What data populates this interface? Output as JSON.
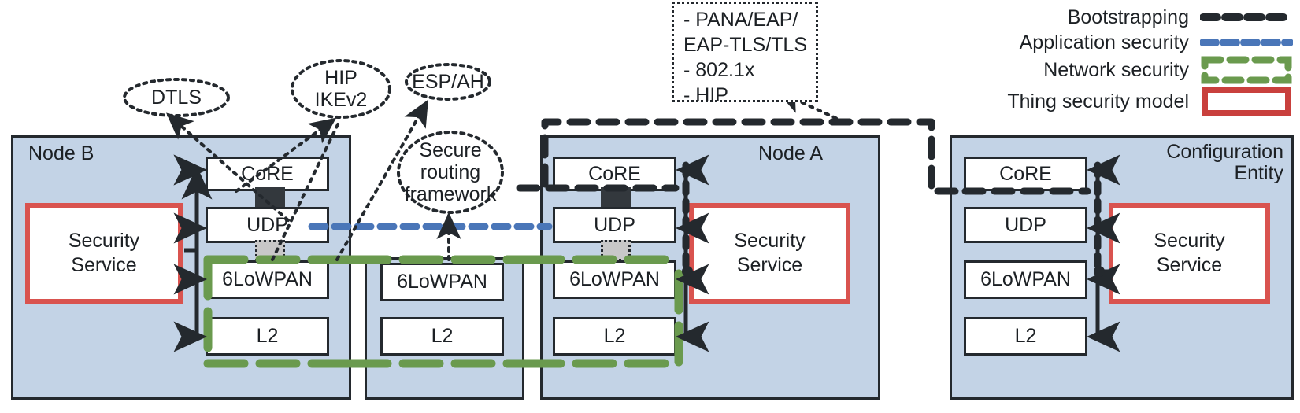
{
  "legend": {
    "items": [
      {
        "label": "Bootstrapping",
        "style": "dashed-black",
        "color": "#24292e"
      },
      {
        "label": "Application security",
        "style": "dotted-blue",
        "color": "#4a76b8"
      },
      {
        "label": "Network security",
        "style": "dashed-green-box",
        "color": "#6a9a4e"
      },
      {
        "label": "Thing security model",
        "style": "solid-red-box",
        "color": "#c9403d"
      }
    ]
  },
  "callout": {
    "lines": [
      "- PANA/EAP/",
      "EAP-TLS/TLS",
      "- 802.1x",
      "- HIP"
    ]
  },
  "ellipses": [
    {
      "id": "dtls",
      "lines": [
        "DTLS"
      ]
    },
    {
      "id": "hip-ikev2",
      "lines": [
        "HIP",
        "IKEv2"
      ]
    },
    {
      "id": "esp-ah",
      "lines": [
        "ESP/AH"
      ]
    },
    {
      "id": "secure-routing",
      "lines": [
        "Secure",
        "routing",
        "framework"
      ]
    }
  ],
  "nodes": [
    {
      "id": "node-b",
      "title_lines": [
        "Node B"
      ],
      "security_service": {
        "lines": [
          "Security",
          "Service"
        ]
      },
      "layers": [
        "CoRE",
        "UDP",
        "6LoWPAN",
        "L2"
      ]
    },
    {
      "id": "node-middle",
      "title_lines": [],
      "security_service": null,
      "layers": [
        "6LoWPAN",
        "L2"
      ]
    },
    {
      "id": "node-a",
      "title_lines": [
        "Node A"
      ],
      "security_service": {
        "lines": [
          "Security",
          "Service"
        ]
      },
      "layers": [
        "CoRE",
        "UDP",
        "6LoWPAN",
        "L2"
      ]
    },
    {
      "id": "config-entity",
      "title_lines": [
        "Configuration",
        "Entity"
      ],
      "security_service": {
        "lines": [
          "Security",
          "Service"
        ]
      },
      "layers": [
        "CoRE",
        "UDP",
        "6LoWPAN",
        "L2"
      ]
    }
  ],
  "colors": {
    "panel_fill": "#c3d3e6",
    "panel_border": "#24292e",
    "thing_security": "#c9403d",
    "network_security": "#6a9a4e",
    "application_security": "#4a76b8",
    "bootstrapping": "#24292e",
    "connector_dark": "#33383d",
    "connector_gray": "#c8c8c8"
  }
}
